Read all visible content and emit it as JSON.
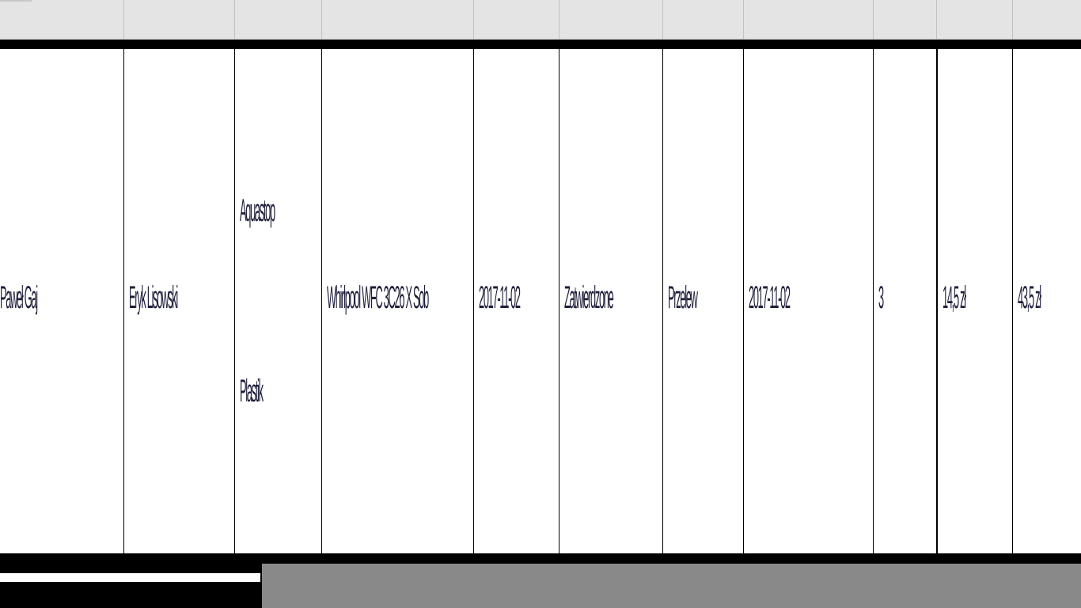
{
  "table": {
    "header_cells": [
      "",
      "",
      "",
      "",
      "",
      "",
      "",
      "",
      "",
      "",
      ""
    ],
    "row": {
      "client": "Paweł Gaj",
      "employee": "Eryk Lisowski",
      "type_line1": "Aquastop",
      "type_line2": "Plastik",
      "device": "Whirlpool WFC 3C26 X Sob",
      "date_received": "2017-11-02",
      "status": "Zatwierdzone",
      "fault": "Przelew",
      "date_done": "2017-11-02",
      "quantity": "3",
      "price": "14,5 zł",
      "total": "43,5 zł"
    }
  },
  "colors": {
    "header_background": "#e4e4e4",
    "bar": "#000000",
    "footer_panel": "#898989",
    "text": "#1e1e3a"
  }
}
